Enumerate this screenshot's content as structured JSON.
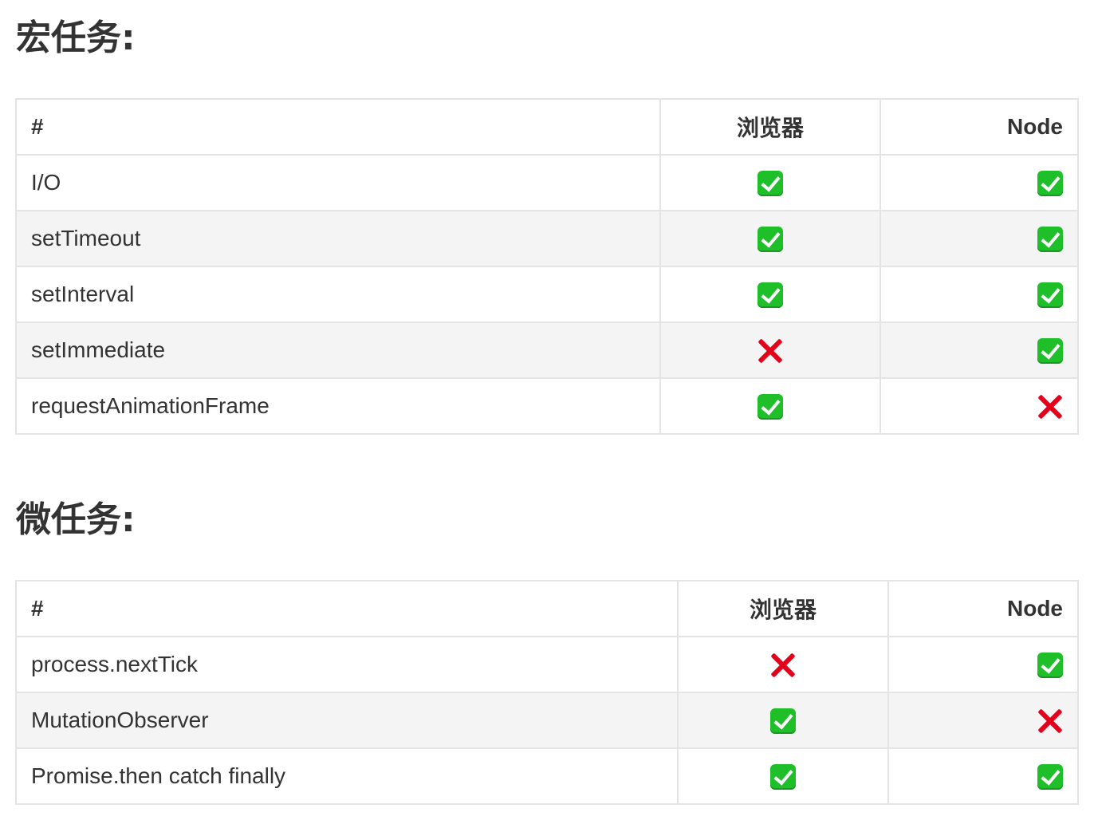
{
  "sections": [
    {
      "title": "宏任务:",
      "headers": {
        "name": "#",
        "browser": "浏览器",
        "node": "Node"
      },
      "rows": [
        {
          "name": "I/O",
          "browser": "yes",
          "node": "yes"
        },
        {
          "name": "setTimeout",
          "browser": "yes",
          "node": "yes"
        },
        {
          "name": "setInterval",
          "browser": "yes",
          "node": "yes"
        },
        {
          "name": "setImmediate",
          "browser": "no",
          "node": "yes"
        },
        {
          "name": "requestAnimationFrame",
          "browser": "yes",
          "node": "no"
        }
      ]
    },
    {
      "title": "微任务:",
      "headers": {
        "name": "#",
        "browser": "浏览器",
        "node": "Node"
      },
      "rows": [
        {
          "name": "process.nextTick",
          "browser": "no",
          "node": "yes"
        },
        {
          "name": "MutationObserver",
          "browser": "yes",
          "node": "no"
        },
        {
          "name": "Promise.then catch finally",
          "browser": "yes",
          "node": "yes"
        }
      ]
    }
  ],
  "marks": {
    "yes": {
      "icon": "check-mark-icon",
      "color": "#1fbf2a"
    },
    "no": {
      "icon": "cross-mark-icon",
      "color": "#e3001b"
    }
  }
}
